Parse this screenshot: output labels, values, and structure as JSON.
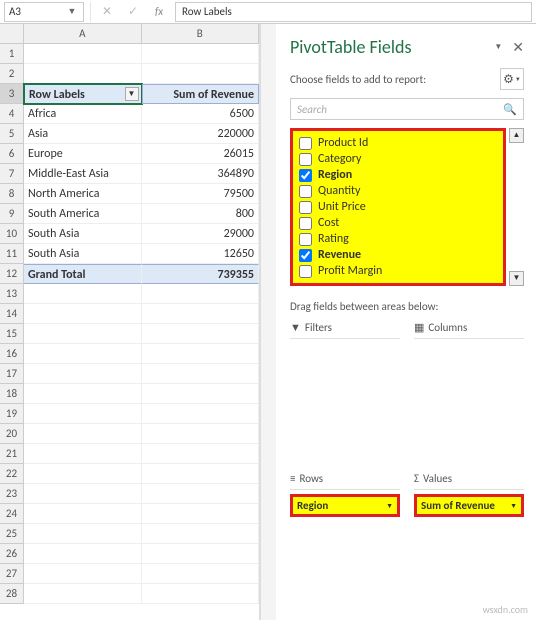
{
  "namebox": "A3",
  "formula": "Row Labels",
  "cols": [
    "A",
    "B"
  ],
  "pivot_headers": {
    "a": "Row Labels",
    "b": "Sum of Revenue"
  },
  "pivot_rows": [
    {
      "label": "Africa",
      "val": "6500"
    },
    {
      "label": "Asia",
      "val": "220000"
    },
    {
      "label": "Europe",
      "val": "26015"
    },
    {
      "label": "Middle-East Asia",
      "val": "364890"
    },
    {
      "label": "North America",
      "val": "79500"
    },
    {
      "label": "South America",
      "val": "800"
    },
    {
      "label": "South Asia",
      "val": "29000"
    },
    {
      "label": "South Asia",
      "val": "12650"
    }
  ],
  "grand_total": {
    "label": "Grand Total",
    "val": "739355"
  },
  "pane": {
    "title": "PivotTable Fields",
    "choose": "Choose fields to add to report:",
    "search": "Search",
    "drag": "Drag fields between areas below:",
    "filters": "Filters",
    "columns": "Columns",
    "rows": "Rows",
    "values": "Values",
    "fields": [
      {
        "name": "Product Id",
        "checked": false
      },
      {
        "name": "Category",
        "checked": false
      },
      {
        "name": "Region",
        "checked": true
      },
      {
        "name": "Quantity",
        "checked": false
      },
      {
        "name": "Unit Price",
        "checked": false
      },
      {
        "name": "Cost",
        "checked": false
      },
      {
        "name": "Rating",
        "checked": false
      },
      {
        "name": "Revenue",
        "checked": true
      },
      {
        "name": "Profit Margin",
        "checked": false
      }
    ],
    "row_chip": "Region",
    "val_chip": "Sum of Revenue"
  },
  "watermark": "wsxdn.com"
}
